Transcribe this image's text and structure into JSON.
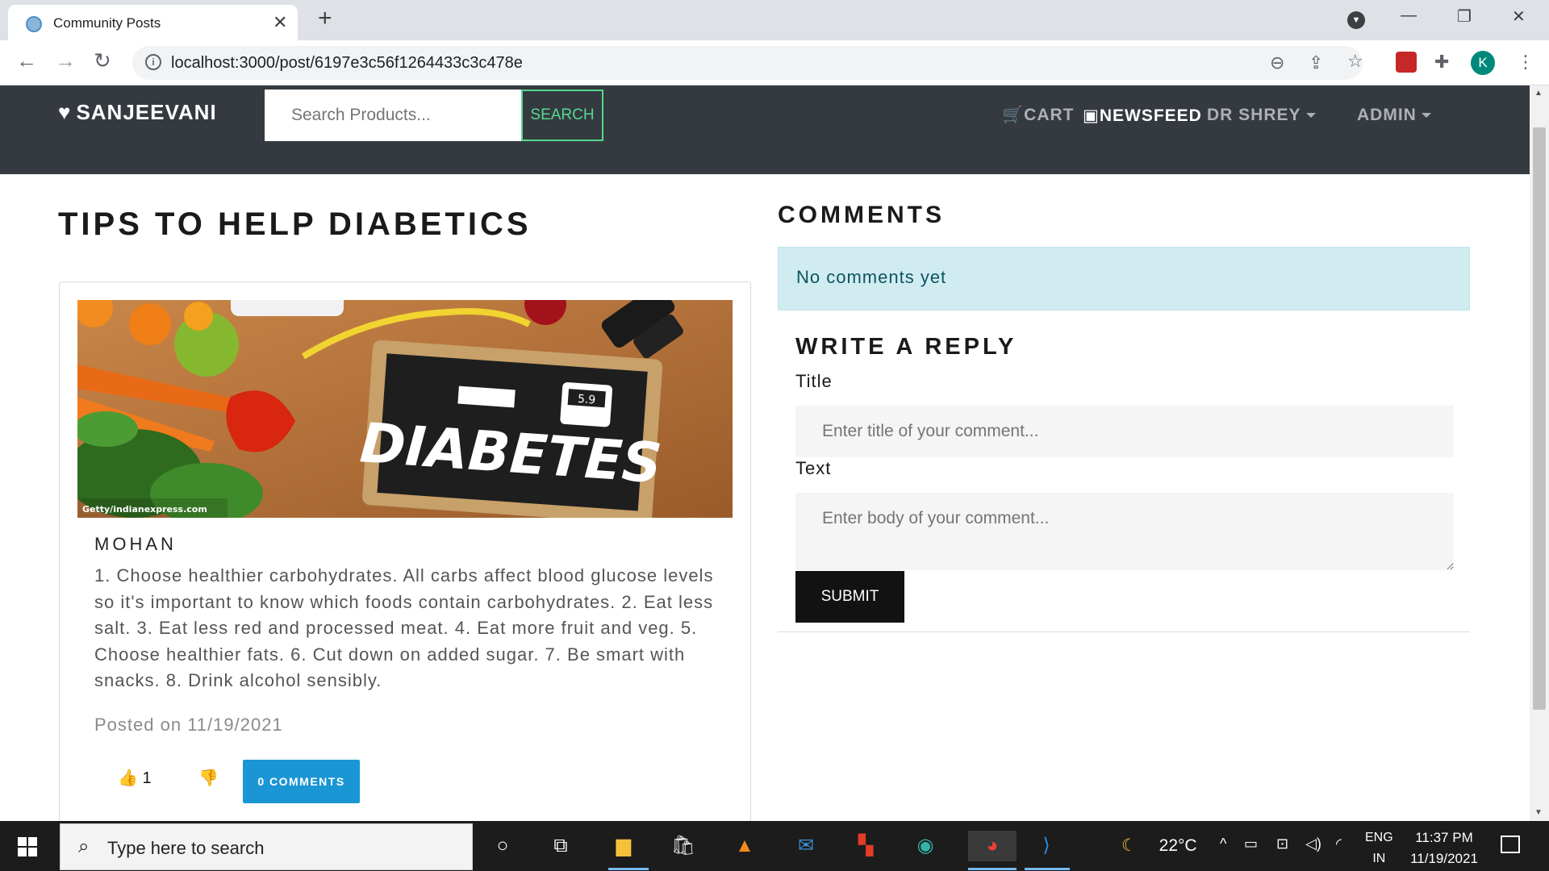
{
  "browser": {
    "tab_title": "Community Posts",
    "tab_close": "✕",
    "new_tab": "+",
    "url": "localhost:3000/post/6197e3c56f1264433c3c478e",
    "profile_initial": "K",
    "window_controls": {
      "minimize": "—",
      "restore": "❐",
      "close": "✕"
    }
  },
  "site": {
    "brand": "SANJEEVANI",
    "search_placeholder": "Search Products...",
    "search_button": "SEARCH",
    "nav": {
      "cart": "CART",
      "newsfeed": "NEWSFEED",
      "user": "DR SHREY",
      "admin": "ADMIN"
    }
  },
  "post": {
    "title": "TIPS TO HELP DIABETICS",
    "image_caption": "Getty/indianexpress.com",
    "image_text": "DIABETES",
    "image_reading": "5.9",
    "author": "MOHAN",
    "body": "1. Choose healthier carbohydrates. All carbs affect blood glucose levels so it's important to know which foods contain carbohydrates. 2. Eat less salt. 3. Eat less red and processed meat. 4. Eat more fruit and veg. 5. Choose healthier fats. 6. Cut down on added sugar. 7. Be smart with snacks. 8. Drink alcohol sensibly.",
    "posted_on": "Posted on 11/19/2021",
    "likes": "1",
    "comments_button": "0 COMMENTS"
  },
  "comments": {
    "heading": "COMMENTS",
    "empty_message": "No comments yet",
    "reply_heading": "WRITE A REPLY",
    "title_label": "Title",
    "title_placeholder": "Enter title of your comment...",
    "text_label": "Text",
    "text_placeholder": "Enter body of your comment...",
    "submit": "SUBMIT"
  },
  "taskbar": {
    "search_placeholder": "Type here to search",
    "temperature": "22°C",
    "language": "ENG",
    "region": "IN",
    "time": "11:37 PM",
    "date": "11/19/2021"
  },
  "colors": {
    "navbar_bg": "#343a40",
    "search_accent": "#55d98f",
    "comments_button": "#1b96d4",
    "alert_bg": "#d1ecf1",
    "alert_text": "#0c5460"
  }
}
